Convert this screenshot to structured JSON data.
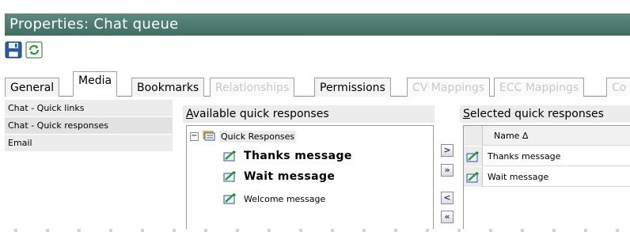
{
  "window": {
    "title": "Properties: Chat queue"
  },
  "toolbar": {
    "save_icon": "floppy-disk-icon",
    "refresh_icon": "refresh-icon"
  },
  "tabs": [
    {
      "label": "General",
      "state": "normal"
    },
    {
      "label": "Media",
      "state": "active"
    },
    {
      "label": "Bookmarks",
      "state": "normal"
    },
    {
      "label": "Relationships",
      "state": "disabled"
    },
    {
      "label": "Permissions",
      "state": "normal"
    },
    {
      "label": "CV Mappings",
      "state": "disabled"
    },
    {
      "label": "ECC Mappings",
      "state": "disabled"
    },
    {
      "label": "Co",
      "state": "disabled"
    }
  ],
  "sidebar": {
    "items": [
      {
        "label": "Chat - Quick links"
      },
      {
        "label": "Chat - Quick responses",
        "selected": true
      },
      {
        "label": "Email"
      }
    ]
  },
  "available": {
    "title_access": "A",
    "title_rest": "vailable quick responses",
    "root": {
      "label": "Quick Responses",
      "expander": "−"
    },
    "items": [
      {
        "label": "Thanks message",
        "bold": true
      },
      {
        "label": "Wait message",
        "bold": true
      },
      {
        "label": "Welcome message",
        "bold": false
      }
    ]
  },
  "move_buttons": {
    "add": ">",
    "add_all": "»",
    "remove": "<",
    "remove_all": "«"
  },
  "selected": {
    "title_access": "S",
    "title_rest": "elected quick responses",
    "column_header": "Name ∆",
    "rows": [
      {
        "name": "Thanks message"
      },
      {
        "name": "Wait message"
      }
    ]
  },
  "colors": {
    "titlebar": "#4c7b70",
    "accent_blue": "#2a3b8f"
  }
}
